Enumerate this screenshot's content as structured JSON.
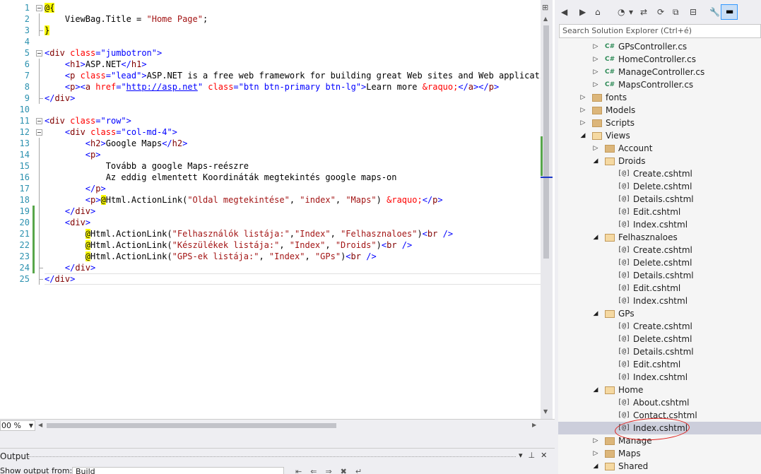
{
  "editor": {
    "lines": [
      {
        "n": "1",
        "html": "<span class='k-raz'>@{</span>"
      },
      {
        "n": "2",
        "html": "    ViewBag.Title = <span class='k-str'>\"Home Page\"</span>;"
      },
      {
        "n": "3",
        "html": "<span class='k-raz'>}</span>"
      },
      {
        "n": "4",
        "html": ""
      },
      {
        "n": "5",
        "html": "<span class='k-brk'>&lt;</span><span class='k-tag'>div</span> <span class='k-attr'>class</span><span class='k-brk'>=</span><span class='k-val'>\"jumbotron\"</span><span class='k-brk'>&gt;</span>"
      },
      {
        "n": "6",
        "html": "    <span class='k-brk'>&lt;</span><span class='k-tag'>h1</span><span class='k-brk'>&gt;</span>ASP.NET<span class='k-brk'>&lt;/</span><span class='k-tag'>h1</span><span class='k-brk'>&gt;</span>"
      },
      {
        "n": "7",
        "html": "    <span class='k-brk'>&lt;</span><span class='k-tag'>p</span> <span class='k-attr'>class</span><span class='k-brk'>=</span><span class='k-val'>\"lead\"</span><span class='k-brk'>&gt;</span>ASP.NET is a free web framework for building great Web sites and Web applications"
      },
      {
        "n": "8",
        "html": "    <span class='k-brk'>&lt;</span><span class='k-tag'>p</span><span class='k-brk'>&gt;&lt;</span><span class='k-tag'>a</span> <span class='k-attr'>href</span><span class='k-brk'>=</span><span class='k-val'>\"</span><span class='k-link'>http://asp.net</span><span class='k-val'>\"</span> <span class='k-attr'>class</span><span class='k-brk'>=</span><span class='k-val'>\"btn btn-primary btn-lg\"</span><span class='k-brk'>&gt;</span>Learn more <span class='k-ent'>&amp;raquo;</span><span class='k-brk'>&lt;/</span><span class='k-tag'>a</span><span class='k-brk'>&gt;&lt;/</span><span class='k-tag'>p</span><span class='k-brk'>&gt;</span>"
      },
      {
        "n": "9",
        "html": "<span class='k-brk'>&lt;/</span><span class='k-tag'>div</span><span class='k-brk'>&gt;</span>"
      },
      {
        "n": "10",
        "html": ""
      },
      {
        "n": "11",
        "html": "<span class='k-brk'>&lt;</span><span class='k-tag'>div</span> <span class='k-attr'>class</span><span class='k-brk'>=</span><span class='k-val'>\"row\"</span><span class='k-brk'>&gt;</span>"
      },
      {
        "n": "12",
        "html": "    <span class='k-brk'>&lt;</span><span class='k-tag'>div</span> <span class='k-attr'>class</span><span class='k-brk'>=</span><span class='k-val'>\"col-md-4\"</span><span class='k-brk'>&gt;</span>"
      },
      {
        "n": "13",
        "html": "        <span class='k-brk'>&lt;</span><span class='k-tag'>h2</span><span class='k-brk'>&gt;</span>Google Maps<span class='k-brk'>&lt;/</span><span class='k-tag'>h2</span><span class='k-brk'>&gt;</span>"
      },
      {
        "n": "14",
        "html": "        <span class='k-brk'>&lt;</span><span class='k-tag'>p</span><span class='k-brk'>&gt;</span>"
      },
      {
        "n": "15",
        "html": "            Tovább a google Maps-reészre"
      },
      {
        "n": "16",
        "html": "            Az eddig elmentett Koordináták megtekintés google maps-on"
      },
      {
        "n": "17",
        "html": "        <span class='k-brk'>&lt;/</span><span class='k-tag'>p</span><span class='k-brk'>&gt;</span>"
      },
      {
        "n": "18",
        "html": "        <span class='k-brk'>&lt;</span><span class='k-tag'>p</span><span class='k-brk'>&gt;</span><span class='k-raz'>@</span>Html.ActionLink(<span class='k-str'>\"Oldal megtekintése\"</span>, <span class='k-str'>\"index\"</span>, <span class='k-str'>\"Maps\"</span>) <span class='k-ent'>&amp;raquo;</span><span class='k-brk'>&lt;/</span><span class='k-tag'>p</span><span class='k-brk'>&gt;</span>"
      },
      {
        "n": "19",
        "html": "    <span class='k-brk'>&lt;/</span><span class='k-tag'>div</span><span class='k-brk'>&gt;</span>"
      },
      {
        "n": "20",
        "html": "    <span class='k-brk'>&lt;</span><span class='k-tag'>div</span><span class='k-brk'>&gt;</span>"
      },
      {
        "n": "21",
        "html": "        <span class='k-raz'>@</span>Html.ActionLink(<span class='k-str'>\"Felhasználók listája:\"</span>,<span class='k-str'>\"Index\"</span>, <span class='k-str'>\"Felhasznaloes\"</span>)<span class='k-brk'>&lt;</span><span class='k-tag'>br</span> <span class='k-brk'>/&gt;</span>"
      },
      {
        "n": "22",
        "html": "        <span class='k-raz'>@</span>Html.ActionLink(<span class='k-str'>\"Készülékek listája:\"</span>, <span class='k-str'>\"Index\"</span>, <span class='k-str'>\"Droids\"</span>)<span class='k-brk'>&lt;</span><span class='k-tag'>br</span> <span class='k-brk'>/&gt;</span>"
      },
      {
        "n": "23",
        "html": "        <span class='k-raz'>@</span>Html.ActionLink(<span class='k-str'>\"GPS-ek listája:\"</span>, <span class='k-str'>\"Index\"</span>, <span class='k-str'>\"GPs\"</span>)<span class='k-brk'>&lt;</span><span class='k-tag'>br</span> <span class='k-brk'>/&gt;</span>"
      },
      {
        "n": "24",
        "html": "    <span class='k-brk'>&lt;/</span><span class='k-tag'>div</span><span class='k-brk'>&gt;</span>"
      },
      {
        "n": "25",
        "html": "<span class='k-brk'>&lt;/</span><span class='k-tag'>div</span><span class='k-brk'>&gt;</span>"
      }
    ],
    "changed_lines": [
      19,
      20,
      21,
      22,
      23,
      24
    ],
    "zoom": "00 %"
  },
  "output": {
    "title": "Output",
    "show_from_label": "Show output from:",
    "show_from_value": "Build"
  },
  "solution_explorer": {
    "search_placeholder": "Search Solution Explorer (Ctrl+é)",
    "items": [
      {
        "label": "GPsController.cs",
        "level": 2,
        "type": "cs",
        "arrow": "closed"
      },
      {
        "label": "HomeController.cs",
        "level": 2,
        "type": "cs",
        "arrow": "closed"
      },
      {
        "label": "ManageController.cs",
        "level": 2,
        "type": "cs",
        "arrow": "closed"
      },
      {
        "label": "MapsController.cs",
        "level": 2,
        "type": "cs",
        "arrow": "closed"
      },
      {
        "label": "fonts",
        "level": 1,
        "type": "folder",
        "arrow": "closed"
      },
      {
        "label": "Models",
        "level": 1,
        "type": "folder",
        "arrow": "closed"
      },
      {
        "label": "Scripts",
        "level": 1,
        "type": "folder",
        "arrow": "closed"
      },
      {
        "label": "Views",
        "level": 1,
        "type": "folder-open",
        "arrow": "open"
      },
      {
        "label": "Account",
        "level": 2,
        "type": "folder",
        "arrow": "closed"
      },
      {
        "label": "Droids",
        "level": 2,
        "type": "folder-open",
        "arrow": "open"
      },
      {
        "label": "Create.cshtml",
        "level": 3,
        "type": "razor",
        "arrow": "none"
      },
      {
        "label": "Delete.cshtml",
        "level": 3,
        "type": "razor",
        "arrow": "none"
      },
      {
        "label": "Details.cshtml",
        "level": 3,
        "type": "razor",
        "arrow": "none"
      },
      {
        "label": "Edit.cshtml",
        "level": 3,
        "type": "razor",
        "arrow": "none"
      },
      {
        "label": "Index.cshtml",
        "level": 3,
        "type": "razor",
        "arrow": "none"
      },
      {
        "label": "Felhasznaloes",
        "level": 2,
        "type": "folder-open",
        "arrow": "open"
      },
      {
        "label": "Create.cshtml",
        "level": 3,
        "type": "razor",
        "arrow": "none"
      },
      {
        "label": "Delete.cshtml",
        "level": 3,
        "type": "razor",
        "arrow": "none"
      },
      {
        "label": "Details.cshtml",
        "level": 3,
        "type": "razor",
        "arrow": "none"
      },
      {
        "label": "Edit.cshtml",
        "level": 3,
        "type": "razor",
        "arrow": "none"
      },
      {
        "label": "Index.cshtml",
        "level": 3,
        "type": "razor",
        "arrow": "none"
      },
      {
        "label": "GPs",
        "level": 2,
        "type": "folder-open",
        "arrow": "open"
      },
      {
        "label": "Create.cshtml",
        "level": 3,
        "type": "razor",
        "arrow": "none"
      },
      {
        "label": "Delete.cshtml",
        "level": 3,
        "type": "razor",
        "arrow": "none"
      },
      {
        "label": "Details.cshtml",
        "level": 3,
        "type": "razor",
        "arrow": "none"
      },
      {
        "label": "Edit.cshtml",
        "level": 3,
        "type": "razor",
        "arrow": "none"
      },
      {
        "label": "Index.cshtml",
        "level": 3,
        "type": "razor",
        "arrow": "none"
      },
      {
        "label": "Home",
        "level": 2,
        "type": "folder-open",
        "arrow": "open"
      },
      {
        "label": "About.cshtml",
        "level": 3,
        "type": "razor",
        "arrow": "none"
      },
      {
        "label": "Contact.cshtml",
        "level": 3,
        "type": "razor",
        "arrow": "none"
      },
      {
        "label": "Index.cshtml",
        "level": 3,
        "type": "razor",
        "arrow": "none",
        "selected": true
      },
      {
        "label": "Manage",
        "level": 2,
        "type": "folder",
        "arrow": "closed"
      },
      {
        "label": "Maps",
        "level": 2,
        "type": "folder",
        "arrow": "closed"
      },
      {
        "label": "Shared",
        "level": 2,
        "type": "folder-open",
        "arrow": "open"
      }
    ]
  }
}
